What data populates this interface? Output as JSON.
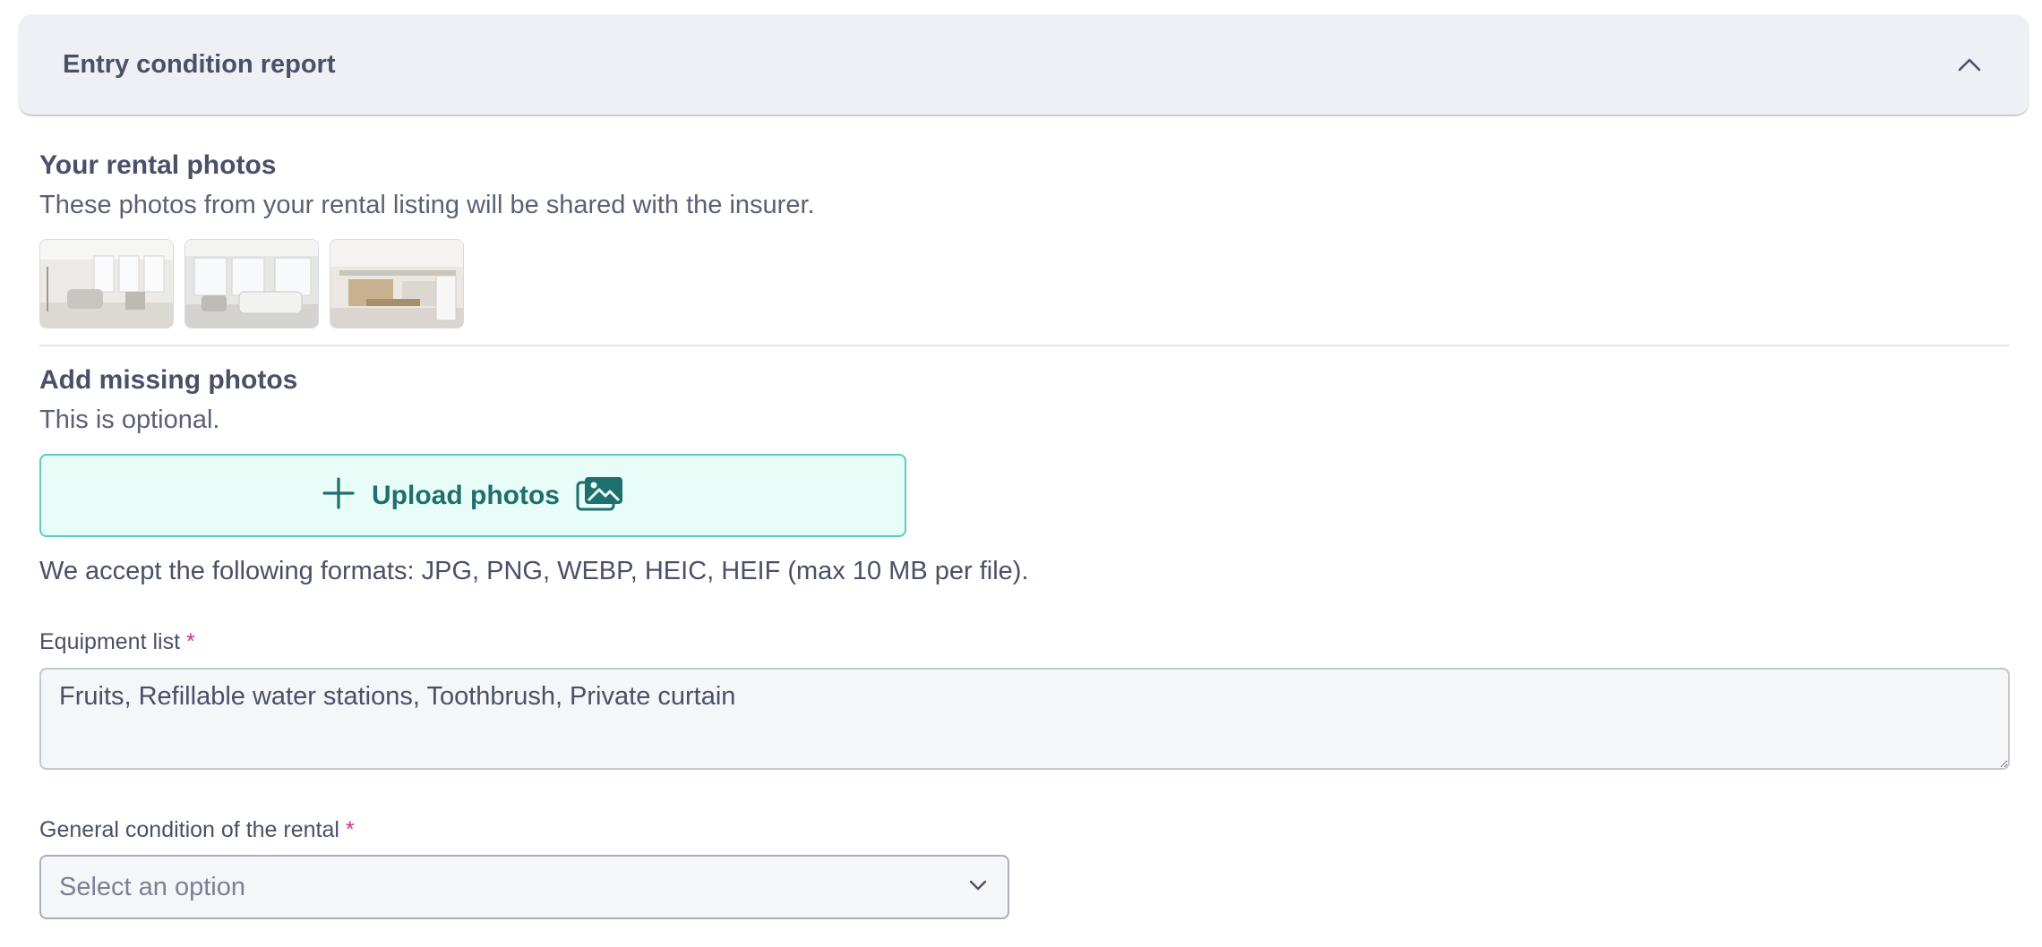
{
  "accordion": {
    "title": "Entry condition report"
  },
  "rental_photos": {
    "heading": "Your rental photos",
    "description": "These photos from your rental listing will be shared with the insurer."
  },
  "missing_photos": {
    "heading": "Add missing photos",
    "description": "This is optional.",
    "upload_label": "Upload photos",
    "formats_note": "We accept the following formats: JPG, PNG, WEBP, HEIC, HEIF (max 10 MB per file)."
  },
  "equipment": {
    "label": "Equipment list",
    "required_mark": "*",
    "value": "Fruits, Refillable water stations, Toothbrush, Private curtain"
  },
  "condition": {
    "label": "General condition of the rental",
    "required_mark": "*",
    "placeholder": "Select an option"
  },
  "colors": {
    "accent_teal": "#1f6f6f",
    "upload_bg": "#e9fdf8",
    "required": "#cc2f8c"
  },
  "icons": [
    "chevron-up-icon",
    "plus-icon",
    "image-gallery-icon",
    "chevron-down-icon",
    "resize-handle-icon"
  ]
}
